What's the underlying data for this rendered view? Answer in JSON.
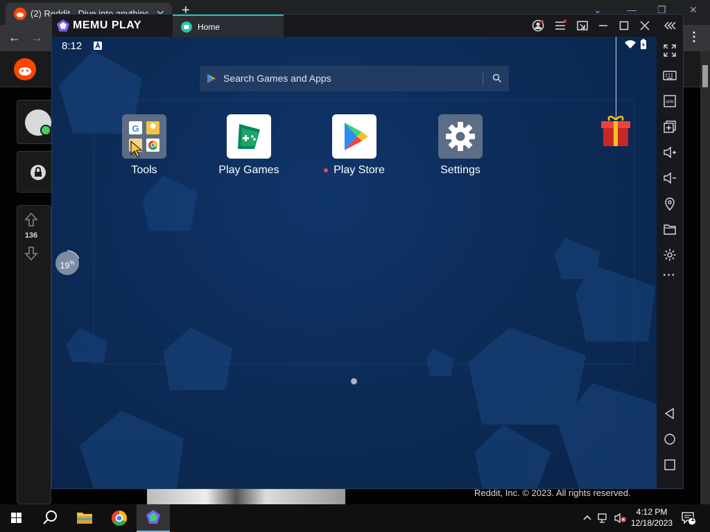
{
  "browser": {
    "tab_title": "(2) Reddit - Dive into anything",
    "tab_close": "✕",
    "new_tab": "+",
    "back": "←",
    "forward": "→",
    "menu": "⋮"
  },
  "reddit": {
    "vote_count": "136",
    "footer": "Reddit, Inc. © 2023. All rights reserved."
  },
  "memu": {
    "brand": "MEMU PLAY",
    "home_tab": "Home",
    "status_time": "8:12",
    "search_placeholder": "Search Games and Apps",
    "apps": [
      {
        "label": "Tools"
      },
      {
        "label": "Play Games"
      },
      {
        "label": "Play Store",
        "has_badge": true
      },
      {
        "label": "Settings"
      }
    ],
    "progress_label": "19",
    "progress_unit": "%",
    "progress_value": 19,
    "sidebar_more": "···"
  },
  "taskbar": {
    "time": "4:12 PM",
    "date": "12/18/2023",
    "notification_count": "1"
  },
  "colors": {
    "accent": "#26c6a9",
    "screen_bg": "#0c2b57",
    "gift_red": "#e53935"
  }
}
